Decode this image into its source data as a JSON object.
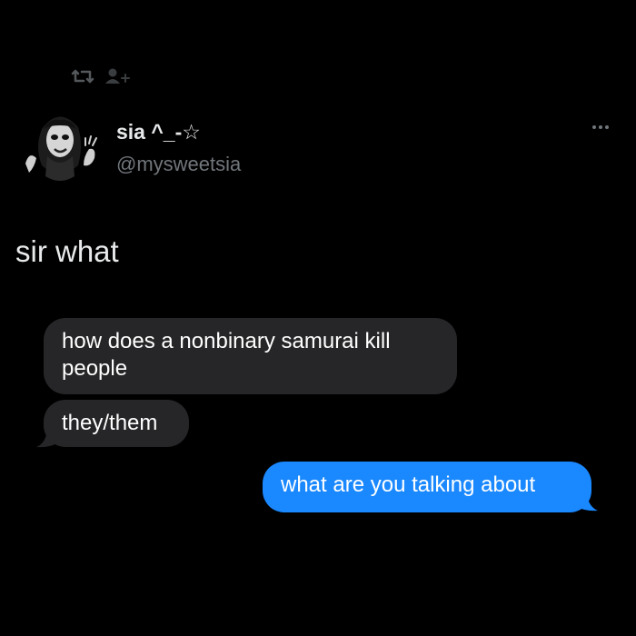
{
  "header": {
    "retweet_icon": "retweet-icon",
    "user_icon": "person-icon"
  },
  "tweet": {
    "avatar": "avatar",
    "display_name": "sia ^_-☆",
    "handle": "@mysweetsia",
    "more_icon": "more-horizontal-icon",
    "text": "sir what"
  },
  "messages": [
    {
      "side": "incoming",
      "text": "how does a nonbinary samurai kill people"
    },
    {
      "side": "incoming",
      "text": "they/them"
    },
    {
      "side": "outgoing",
      "text": "what are you talking about"
    }
  ],
  "colors": {
    "background": "#000000",
    "incoming_bubble": "#262628",
    "outgoing_bubble": "#1a88ff",
    "handle": "#71767b"
  }
}
